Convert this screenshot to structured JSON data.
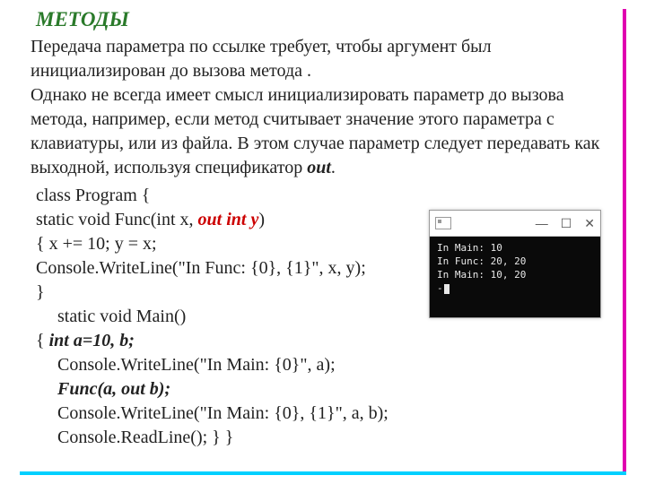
{
  "title": "МЕТОДЫ",
  "paragraph1": "Передача параметра по ссылке требует, чтобы аргумент был инициализирован до вызова метода .",
  "paragraph2_a": "Однако не всегда имеет смысл инициализировать параметр до вызова метода, например, если метод считывает значение этого параметра с клавиатуры, или из файла. В этом случае параметр следует передавать как выходной, используя  спецификатор ",
  "paragraph2_em": "out",
  "paragraph2_b": ".",
  "code": {
    "l1": " class Program {",
    "l2a": " static void Func(int x, ",
    "l2b": "out int y",
    "l2c": ")",
    "l3": "{  x += 10; y = x;",
    "l4": " Console.WriteLine(\"In Func: {0}, {1}\", x, y);",
    "l5": "}",
    "l6": "static void Main()",
    "l7a": "{   ",
    "l7b": "int a=10, b;",
    "l8": "Console.WriteLine(\"In Main: {0}\", a);",
    "l9": "Func(a, out b);",
    "l10": "Console.WriteLine(\"In Main: {0}, {1}\", a, b);",
    "l11": "Console.ReadLine();  }     }"
  },
  "console": {
    "min": "—",
    "max": "☐",
    "close": "✕",
    "line1": "In Main: 10",
    "line2": "In Func: 20, 20",
    "line3": "In Main: 10, 20",
    "prompt": "-"
  }
}
